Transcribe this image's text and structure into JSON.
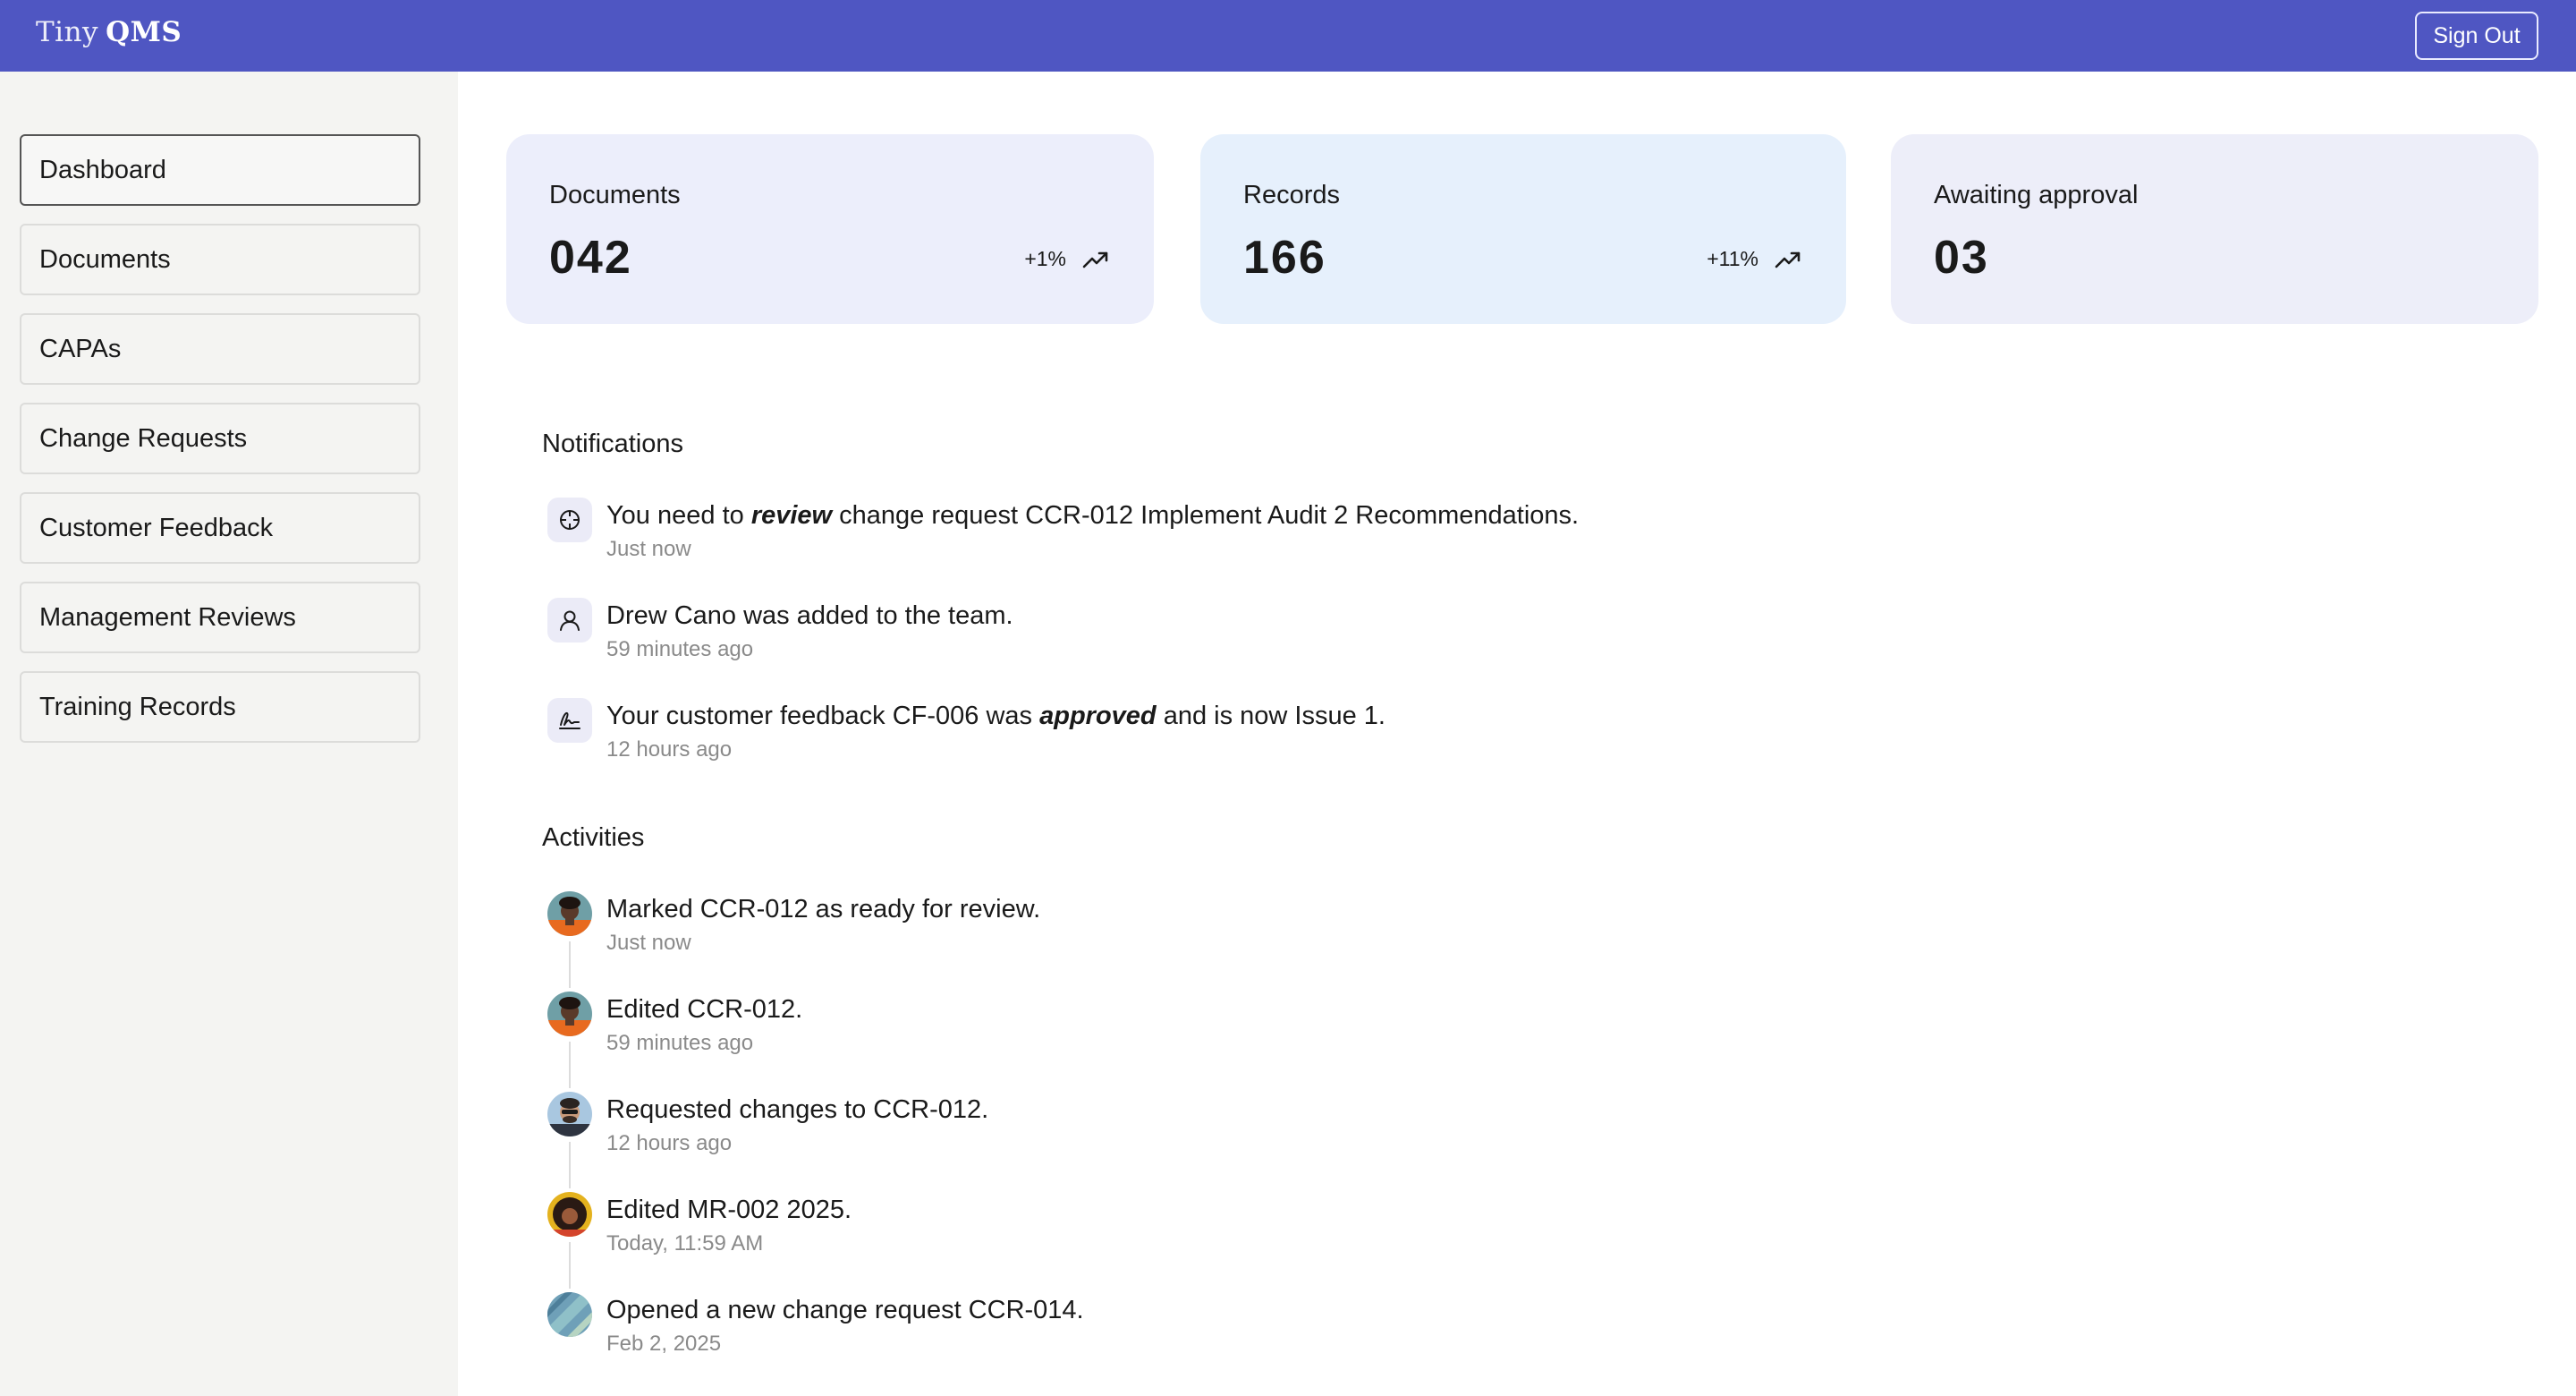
{
  "app": {
    "logo_light": "Tiny",
    "logo_bold": "QMS",
    "sign_out_label": "Sign Out"
  },
  "sidebar": {
    "items": [
      {
        "label": "Dashboard",
        "active": true
      },
      {
        "label": "Documents",
        "active": false
      },
      {
        "label": "CAPAs",
        "active": false
      },
      {
        "label": "Change Requests",
        "active": false
      },
      {
        "label": "Customer Feedback",
        "active": false
      },
      {
        "label": "Management Reviews",
        "active": false
      },
      {
        "label": "Training Records",
        "active": false
      }
    ]
  },
  "stats": [
    {
      "title": "Documents",
      "value": "042",
      "trend": "+1%",
      "trend_icon": "trending-up-icon",
      "bg": "#eceefb"
    },
    {
      "title": "Records",
      "value": "166",
      "trend": "+11%",
      "trend_icon": "trending-up-icon",
      "bg": "#e6f0fc"
    },
    {
      "title": "Awaiting approval",
      "value": "03",
      "trend": "",
      "bg": "#edeef9"
    }
  ],
  "notifications": {
    "title": "Notifications",
    "items": [
      {
        "icon": "crosshair-icon",
        "pre": "You need to ",
        "emphasis": "review",
        "post": " change request CCR-012 Implement Audit 2 Recommendations.",
        "time": "Just now"
      },
      {
        "icon": "user-icon",
        "pre": "Drew Cano was added to the team.",
        "emphasis": "",
        "post": "",
        "time": "59 minutes ago"
      },
      {
        "icon": "signature-icon",
        "pre": "Your customer feedback CF-006 was ",
        "emphasis": "approved",
        "post": " and is now Issue 1.",
        "time": "12 hours ago"
      }
    ]
  },
  "activities": {
    "title": "Activities",
    "items": [
      {
        "text": "Marked CCR-012 as ready for review.",
        "time": "Just now"
      },
      {
        "text": "Edited CCR-012.",
        "time": "59 minutes ago"
      },
      {
        "text": "Requested changes to CCR-012.",
        "time": "12 hours ago"
      },
      {
        "text": "Edited MR-002 2025.",
        "time": "Today, 11:59 AM"
      },
      {
        "text": "Opened a new change request CCR-014.",
        "time": "Feb 2, 2025"
      }
    ]
  },
  "colors": {
    "topbar": "#4f56c2",
    "sidebar_bg": "#f4f4f2",
    "muted_text": "#8a8a8a"
  }
}
